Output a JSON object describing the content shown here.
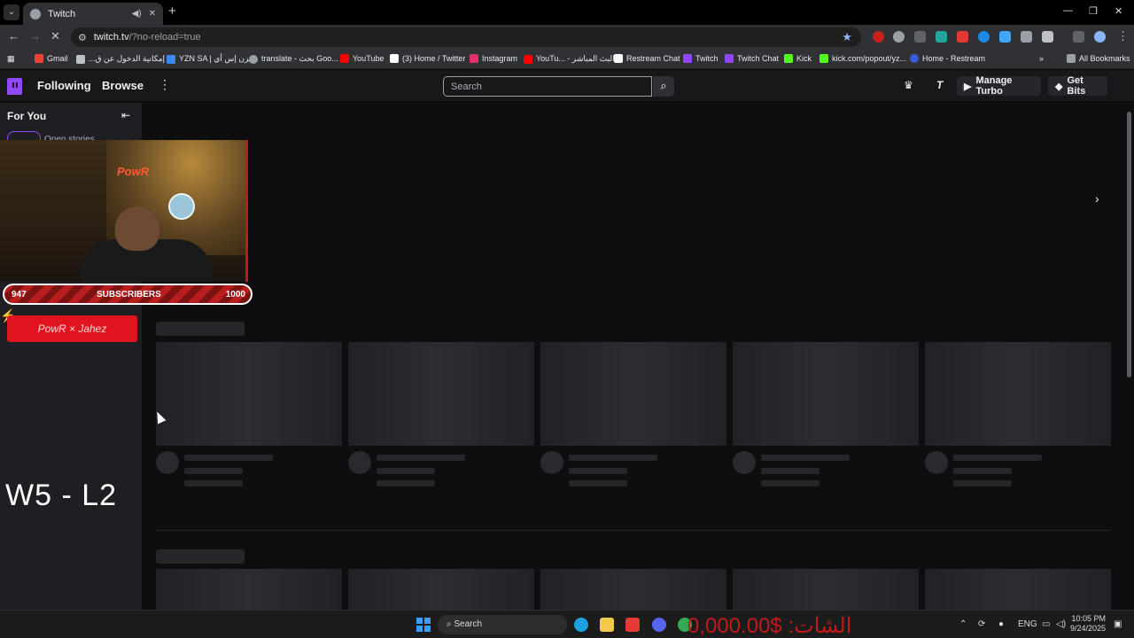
{
  "browser": {
    "tab_title": "Twitch",
    "url_host": "twitch.tv",
    "url_path": "/?no-reload=true",
    "new_tab_label": "+",
    "controls": {
      "minimize": "—",
      "restore": "❐",
      "close": "✕"
    }
  },
  "bookmarks": {
    "items": [
      {
        "label": "Gmail",
        "color": "#ea4335"
      },
      {
        "label": "...إمكانية الدخول عن ق",
        "color": "#bdc1c6"
      },
      {
        "label": "YZN SA | يزن إس أي",
        "color": "#4285f4"
      },
      {
        "label": "translate - بحث Goo...",
        "color": "#9aa0a6"
      },
      {
        "label": "YouTube",
        "color": "#ff0000"
      },
      {
        "label": "(3) Home / Twitter",
        "color": "#ffffff"
      },
      {
        "label": "Instagram",
        "color": "#e1306c"
      },
      {
        "label": "YouTu... - البث المباشر",
        "color": "#ff0000"
      },
      {
        "label": "Restream Chat",
        "color": "#ffffff"
      },
      {
        "label": "Twitch",
        "color": "#9146ff"
      },
      {
        "label": "Twitch Chat",
        "color": "#9146ff"
      },
      {
        "label": "Kick",
        "color": "#53fc18"
      },
      {
        "label": "kick.com/popout/yz...",
        "color": "#53fc18"
      },
      {
        "label": "Home - Restream",
        "color": "#3b5bdb"
      }
    ],
    "all_bookmarks": "All Bookmarks",
    "overflow": "»"
  },
  "twitch": {
    "nav": {
      "following": "Following",
      "browse": "Browse"
    },
    "search_placeholder": "Search",
    "manage_turbo": "Manage Turbo",
    "get_bits": "Get Bits",
    "sidebar": {
      "title": "For You",
      "stories_label": "Open stories"
    },
    "accent": "#9146ff"
  },
  "overlay": {
    "cam_logo": "PowR",
    "subs_current": "947",
    "subs_label": "SUBSCRIBERS",
    "subs_goal": "1000",
    "sponsor_text": "PowR × Jahez",
    "score": "W5 - L2",
    "taskbar_text": "الشات: $0,000.00"
  },
  "taskbar": {
    "search_label": "Search",
    "lang": "ENG",
    "time": "10:05 PM",
    "date": "9/24/2025"
  }
}
